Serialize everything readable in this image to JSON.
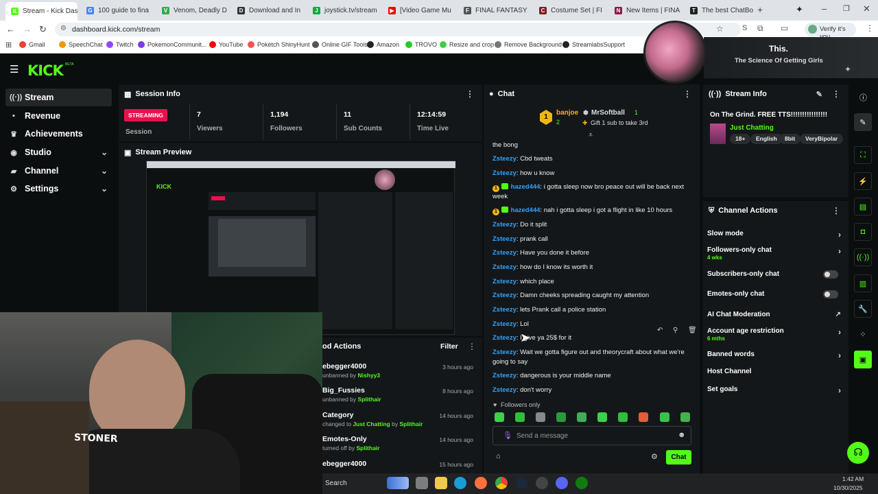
{
  "browser": {
    "tabs": [
      {
        "title": "Stream - Kick Das",
        "color": "#53fc18",
        "letter": "K",
        "active": true
      },
      {
        "title": "100 guide to fina",
        "color": "#4285f4",
        "letter": "G"
      },
      {
        "title": "Venom, Deadly D",
        "color": "#3a5",
        "letter": "V"
      },
      {
        "title": "Download and In",
        "color": "#333",
        "letter": "D"
      },
      {
        "title": "joystick.tv/stream",
        "color": "#1a4",
        "letter": "J"
      },
      {
        "title": "[Video Game Mu",
        "color": "#e00",
        "letter": "▶"
      },
      {
        "title": "FINAL FANTASY",
        "color": "#555",
        "letter": "F"
      },
      {
        "title": "Costume Set | FI",
        "color": "#7a2020",
        "letter": "C"
      },
      {
        "title": "New Items | FINA",
        "color": "#8b1a4a",
        "letter": "N"
      },
      {
        "title": "The best ChatBo",
        "color": "#222",
        "letter": "T"
      }
    ],
    "url": "dashboard.kick.com/stream",
    "profile_label": "Verify it's you",
    "bookmarks": [
      "Gmail",
      "SpeechChat",
      "Twitch",
      "PokemonCommunit...",
      "YouTube",
      "Pokétch ShinyHunt",
      "Online GIF Tools",
      "Amazon",
      "TROVO",
      "Resize and crop",
      "Remove Background",
      "StreamlabsSupport",
      "kmarks"
    ]
  },
  "overlay": {
    "title": "This.",
    "subtitle": "The Science Of Getting Girls"
  },
  "sidebar": {
    "items": [
      {
        "label": "Stream",
        "icon": "stream-icon"
      },
      {
        "label": "Revenue",
        "icon": "revenue-icon"
      },
      {
        "label": "Achievements",
        "icon": "trophy-icon"
      },
      {
        "label": "Studio",
        "icon": "studio-icon"
      },
      {
        "label": "Channel",
        "icon": "channel-icon"
      },
      {
        "label": "Settings",
        "icon": "gear-icon"
      }
    ]
  },
  "session": {
    "title": "Session Info",
    "badge": "STREAMING",
    "session_label": "Session",
    "stats": [
      {
        "value": "7",
        "label": "Viewers"
      },
      {
        "value": "1,194",
        "label": "Followers"
      },
      {
        "value": "11",
        "label": "Sub Counts"
      },
      {
        "value": "12:14:59",
        "label": "Time Live"
      }
    ]
  },
  "preview": {
    "title": "Stream Preview",
    "webcam_sign": "STONER"
  },
  "mod_actions": {
    "title": "od Actions",
    "filter": "Filter",
    "items": [
      {
        "title": "ebegger4000",
        "pre": "unbanned by ",
        "by": "Nishyy3",
        "mid": "",
        "by2": "",
        "time": "3 hours ago"
      },
      {
        "title": "Big_Fussies",
        "pre": "unbanned by ",
        "by": "Splithair",
        "mid": "",
        "by2": "",
        "time": "8 hours ago"
      },
      {
        "title": "Category",
        "pre": "changed to ",
        "by": "Just Chatting",
        "mid": " by ",
        "by2": "Splithair",
        "time": "14 hours ago"
      },
      {
        "title": "Emotes-Only",
        "pre": "turned off by ",
        "by": "Splithair",
        "mid": "",
        "by2": "",
        "time": "14 hours ago"
      },
      {
        "title": "ebegger4000",
        "pre": "",
        "by": "",
        "mid": "",
        "by2": "",
        "time": "15 hours ago"
      }
    ]
  },
  "chat": {
    "title": "Chat",
    "leader": {
      "rank1": "1",
      "user1": "banjoe",
      "count1": "2",
      "user2": "MrSoftball",
      "count2": "1",
      "gift": "Gift 1 sub to take 3rd"
    },
    "messages": [
      {
        "user": "",
        "text": "the bong",
        "badges": false
      },
      {
        "user": "Zsteezy",
        "text": ": Cbd tweats",
        "badges": false
      },
      {
        "user": "Zsteezy",
        "text": ": how u know",
        "badges": false
      },
      {
        "user": "hazed444",
        "text": ": i gotta sleep now bro peace out will be back next week",
        "badges": true
      },
      {
        "user": "hazed444",
        "text": ": nah i gotta sleep i got a flight in like 10 hours",
        "badges": true
      },
      {
        "user": "Zsteezy",
        "text": ": Do it split",
        "badges": false
      },
      {
        "user": "Zsteezy",
        "text": ": prank call",
        "badges": false
      },
      {
        "user": "Zsteezy",
        "text": ": Have you done it before",
        "badges": false
      },
      {
        "user": "Zsteezy",
        "text": ": how do I know its worth it",
        "badges": false
      },
      {
        "user": "Zsteezy",
        "text": ": which place",
        "badges": false
      },
      {
        "user": "Zsteezy",
        "text": ": Damn cheeks spreading caught my attention",
        "badges": false
      },
      {
        "user": "Zsteezy",
        "text": ": lets Prank call a police station",
        "badges": false
      },
      {
        "user": "Zsteezy",
        "text": ": Lol",
        "badges": false
      },
      {
        "user": "Zsteezy",
        "text": ": I give ya 25$ for it",
        "badges": false
      },
      {
        "user": "Zsteezy",
        "text": ": Wait we gotta figure out and theorycraft about what we're going to say",
        "badges": false
      },
      {
        "user": "Zsteezy",
        "text": ": dangerous is your middle name",
        "badges": false
      },
      {
        "user": "Zsteezy",
        "text": ": don't worry",
        "badges": false
      }
    ],
    "followers_only": "Followers only",
    "placeholder": "Send a message",
    "send": "Chat"
  },
  "stream_info": {
    "title": "Stream Info",
    "stream_title": "On The Grind. FREE TTS!!!!!!!!!!!!!!!!",
    "category": "Just Chatting",
    "tags": [
      "18+",
      "English",
      "8bit",
      "VeryBipolar"
    ]
  },
  "channel_actions": {
    "title": "Channel Actions",
    "items": [
      {
        "label": "Slow mode",
        "sub": "",
        "control": "arrow"
      },
      {
        "label": "Followers-only chat",
        "sub": "4 wks",
        "control": "arrow"
      },
      {
        "label": "Subscribers-only chat",
        "sub": "",
        "control": "toggle"
      },
      {
        "label": "Emotes-only chat",
        "sub": "",
        "control": "toggle"
      },
      {
        "label": "AI Chat Moderation",
        "sub": "",
        "control": "external"
      },
      {
        "label": "Account age restriction",
        "sub": "6 mths",
        "control": "arrow"
      },
      {
        "label": "Banned words",
        "sub": "",
        "control": "arrow"
      },
      {
        "label": "Host Channel",
        "sub": "",
        "control": "none"
      },
      {
        "label": "Set goals",
        "sub": "",
        "control": "arrow"
      }
    ]
  },
  "taskbar": {
    "search": "Search",
    "time": "1:42 AM",
    "date": "10/30/2025"
  }
}
